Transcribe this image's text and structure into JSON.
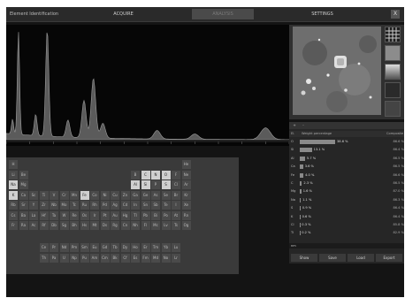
{
  "app_title": "Element Identification",
  "tabs": [
    "ACQUIRE",
    "ANALYSIS",
    "SETTINGS"
  ],
  "close_label": "X",
  "spectrum": {
    "status_left": "90 000 counts in 60 seconds",
    "status_center": "Emission energy (keV)",
    "peaks": [
      {
        "energy": 0.27,
        "rel": 0.14
      },
      {
        "energy": 0.52,
        "rel": 0.97
      },
      {
        "energy": 1.25,
        "rel": 0.2
      },
      {
        "energy": 1.74,
        "rel": 1.0
      },
      {
        "energy": 2.62,
        "rel": 0.16
      },
      {
        "energy": 3.3,
        "rel": 0.35
      },
      {
        "energy": 3.7,
        "rel": 0.56
      },
      {
        "energy": 4.1,
        "rel": 0.14
      },
      {
        "energy": 6.4,
        "rel": 0.08
      },
      {
        "energy": 8.0,
        "rel": 0.05
      },
      {
        "energy": 11.0,
        "rel": 0.11
      }
    ],
    "energy_range": [
      0,
      12
    ]
  },
  "periodic_table": {
    "selected": [
      "C",
      "N",
      "O",
      "Na",
      "Al",
      "Si",
      "S",
      "K",
      "Fe"
    ]
  },
  "results": {
    "tab_labels": [
      "+",
      "-"
    ],
    "header_element": "El.",
    "header_weight": "Weight percentage",
    "header_comp": "Composite",
    "rows": [
      {
        "symbol": "O",
        "pct": "38.6 %",
        "weight": 38.6,
        "comp": "86.6 %"
      },
      {
        "symbol": "Si",
        "pct": "13.1 %",
        "weight": 13.1,
        "comp": "86.4 %"
      },
      {
        "symbol": "Al",
        "pct": "5.7 %",
        "weight": 5.7,
        "comp": "86.5 %"
      },
      {
        "symbol": "Ca",
        "pct": "3.6 %",
        "weight": 3.6,
        "comp": "86.5 %"
      },
      {
        "symbol": "Fe",
        "pct": "4.0 %",
        "weight": 4.0,
        "comp": "86.6 %"
      },
      {
        "symbol": "C",
        "pct": "2.3 %",
        "weight": 2.3,
        "comp": "86.5 %"
      },
      {
        "symbol": "Mg",
        "pct": "1.6 %",
        "weight": 1.6,
        "comp": "87.0 %"
      },
      {
        "symbol": "Na",
        "pct": "1.1 %",
        "weight": 1.1,
        "comp": "86.3 %"
      },
      {
        "symbol": "S",
        "pct": "0.9 %",
        "weight": 0.9,
        "comp": "86.4 %"
      },
      {
        "symbol": "K",
        "pct": "0.6 %",
        "weight": 0.6,
        "comp": "86.4 %"
      },
      {
        "symbol": "Cl",
        "pct": "0.3 %",
        "weight": 0.3,
        "comp": "85.8 %"
      },
      {
        "symbol": "Ti",
        "pct": "0.2 %",
        "weight": 0.2,
        "comp": "82.9 %"
      }
    ],
    "footer_label": "nm",
    "buttons": [
      "Show",
      "Save",
      "Load",
      "Export"
    ]
  }
}
